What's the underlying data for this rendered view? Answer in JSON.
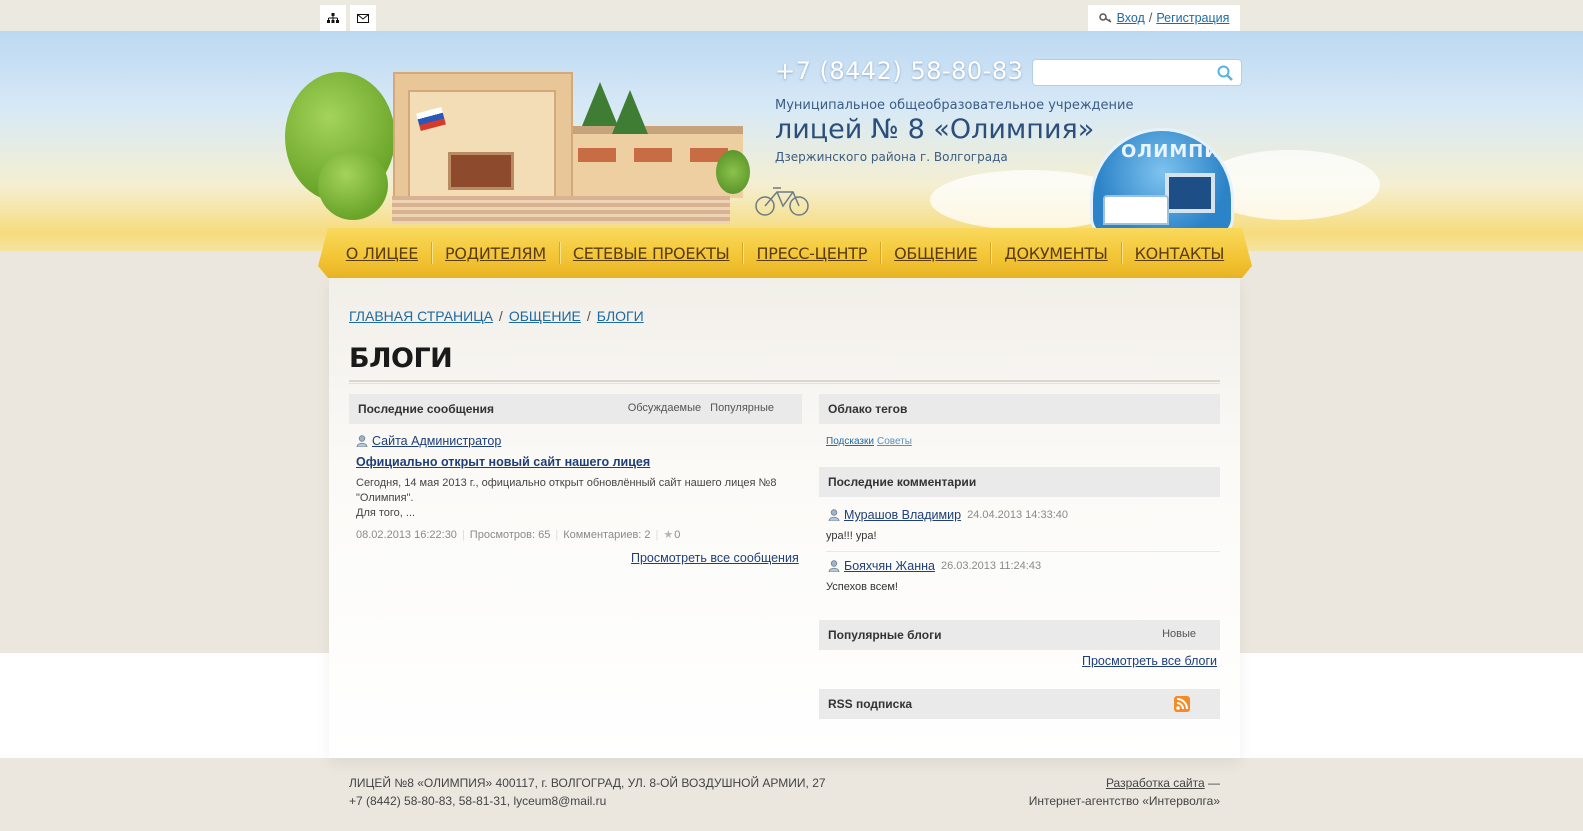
{
  "auth": {
    "login_label": "Вход",
    "separator": "/",
    "register_label": "Регистрация"
  },
  "header": {
    "phone": "+7 (8442) 58-80-83",
    "search_placeholder": "",
    "org_subtitle": "Муниципальное общеобразовательное учреждение",
    "org_title": "лицей № 8 «Олимпия»",
    "org_location": "Дзержинского района г. Волгограда",
    "logo_text": "ОЛИМПИЯ"
  },
  "nav": {
    "items": [
      {
        "label": "О ЛИЦЕЕ"
      },
      {
        "label": "РОДИТЕЛЯМ"
      },
      {
        "label": "СЕТЕВЫЕ ПРОЕКТЫ"
      },
      {
        "label": "ПРЕСС-ЦЕНТР"
      },
      {
        "label": "ОБЩЕНИЕ"
      },
      {
        "label": "ДОКУМЕНТЫ"
      },
      {
        "label": "КОНТАКТЫ"
      }
    ]
  },
  "breadcrumb": {
    "items": [
      "ГЛАВНАЯ СТРАНИЦА",
      "ОБЩЕНИЕ",
      "БЛОГИ"
    ],
    "separator": "/"
  },
  "page_title": "БЛОГИ",
  "latest_posts": {
    "heading": "Последние сообщения",
    "tabs": [
      "Обсуждаемые",
      "Популярные"
    ],
    "post": {
      "author": "Сайта Администратор",
      "title": "Официально открыт новый сайт нашего лицея",
      "excerpt_line1": "Сегодня, 14 мая 2013 г., официально открыт обновлённый сайт нашего лицея №8",
      "excerpt_line2": "\"Олимпия\".",
      "excerpt_line3": "Для того, ...",
      "date": "08.02.2013 16:22:30",
      "views": "Просмотров: 65",
      "comments": "Комментариев: 2",
      "rating": "0"
    },
    "view_all": "Просмотреть все сообщения"
  },
  "tag_cloud": {
    "heading": "Облако тегов",
    "tags": [
      "Подсказки",
      "Советы"
    ]
  },
  "latest_comments": {
    "heading": "Последние комментарии",
    "items": [
      {
        "author": "Мурашов Владимир",
        "date": "24.04.2013 14:33:40",
        "text": "ура!!! ура!"
      },
      {
        "author": "Бояхчян Жанна",
        "date": "26.03.2013 11:24:43",
        "text": "Успехов всем!"
      }
    ]
  },
  "popular_blogs": {
    "heading": "Популярные блоги",
    "tab": "Новые",
    "view_all": "Просмотреть все блоги"
  },
  "rss": {
    "heading": "RSS подписка",
    "icon": "rss-icon"
  },
  "footer": {
    "address": "ЛИЦЕЙ №8 «ОЛИМПИЯ» 400117, г. ВОЛГОГРАД, УЛ. 8-ОЙ ВОЗДУШНОЙ АРМИИ, 27",
    "contacts": "+7 (8442) 58-80-83, 58-81-31, lyceum8@mail.ru",
    "dev_link": "Разработка сайта",
    "dev_dash": "—",
    "agency": "Интернет-агентство «Интерволга»"
  },
  "colors": {
    "accent_link": "#1e6aa3",
    "nav_yellow": "#f4c637",
    "title_blue": "#2a4f7c"
  }
}
